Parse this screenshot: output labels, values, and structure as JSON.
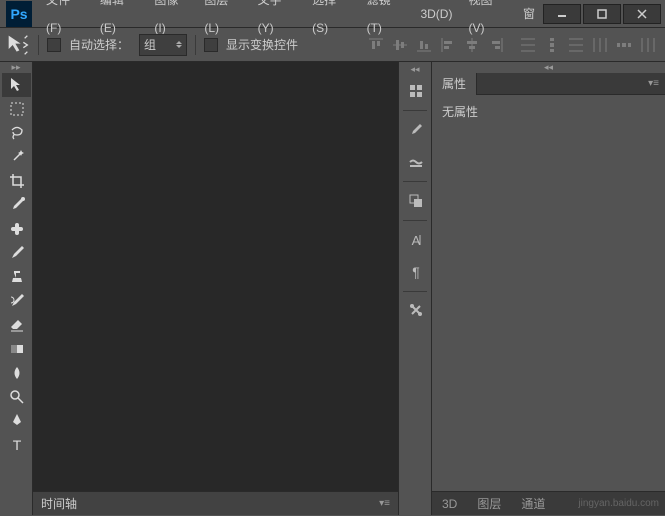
{
  "app": {
    "logo": "Ps"
  },
  "menu": {
    "file": "文件(F)",
    "edit": "编辑(E)",
    "image": "图像(I)",
    "layer": "图层(L)",
    "type": "文字(Y)",
    "select": "选择(S)",
    "filter": "滤镜(T)",
    "threed": "3D(D)",
    "view": "视图(V)",
    "window": "窗"
  },
  "options": {
    "auto_select_label": "自动选择：",
    "auto_select_value": "组",
    "show_transform_label": "显示变换控件"
  },
  "timeline": {
    "label": "时间轴"
  },
  "properties": {
    "tab_label": "属性",
    "empty_text": "无属性"
  },
  "bottom_tabs": {
    "threed": "3D",
    "layers": "图层",
    "channels": "通道"
  },
  "watermark": "jingyan.baidu.com"
}
